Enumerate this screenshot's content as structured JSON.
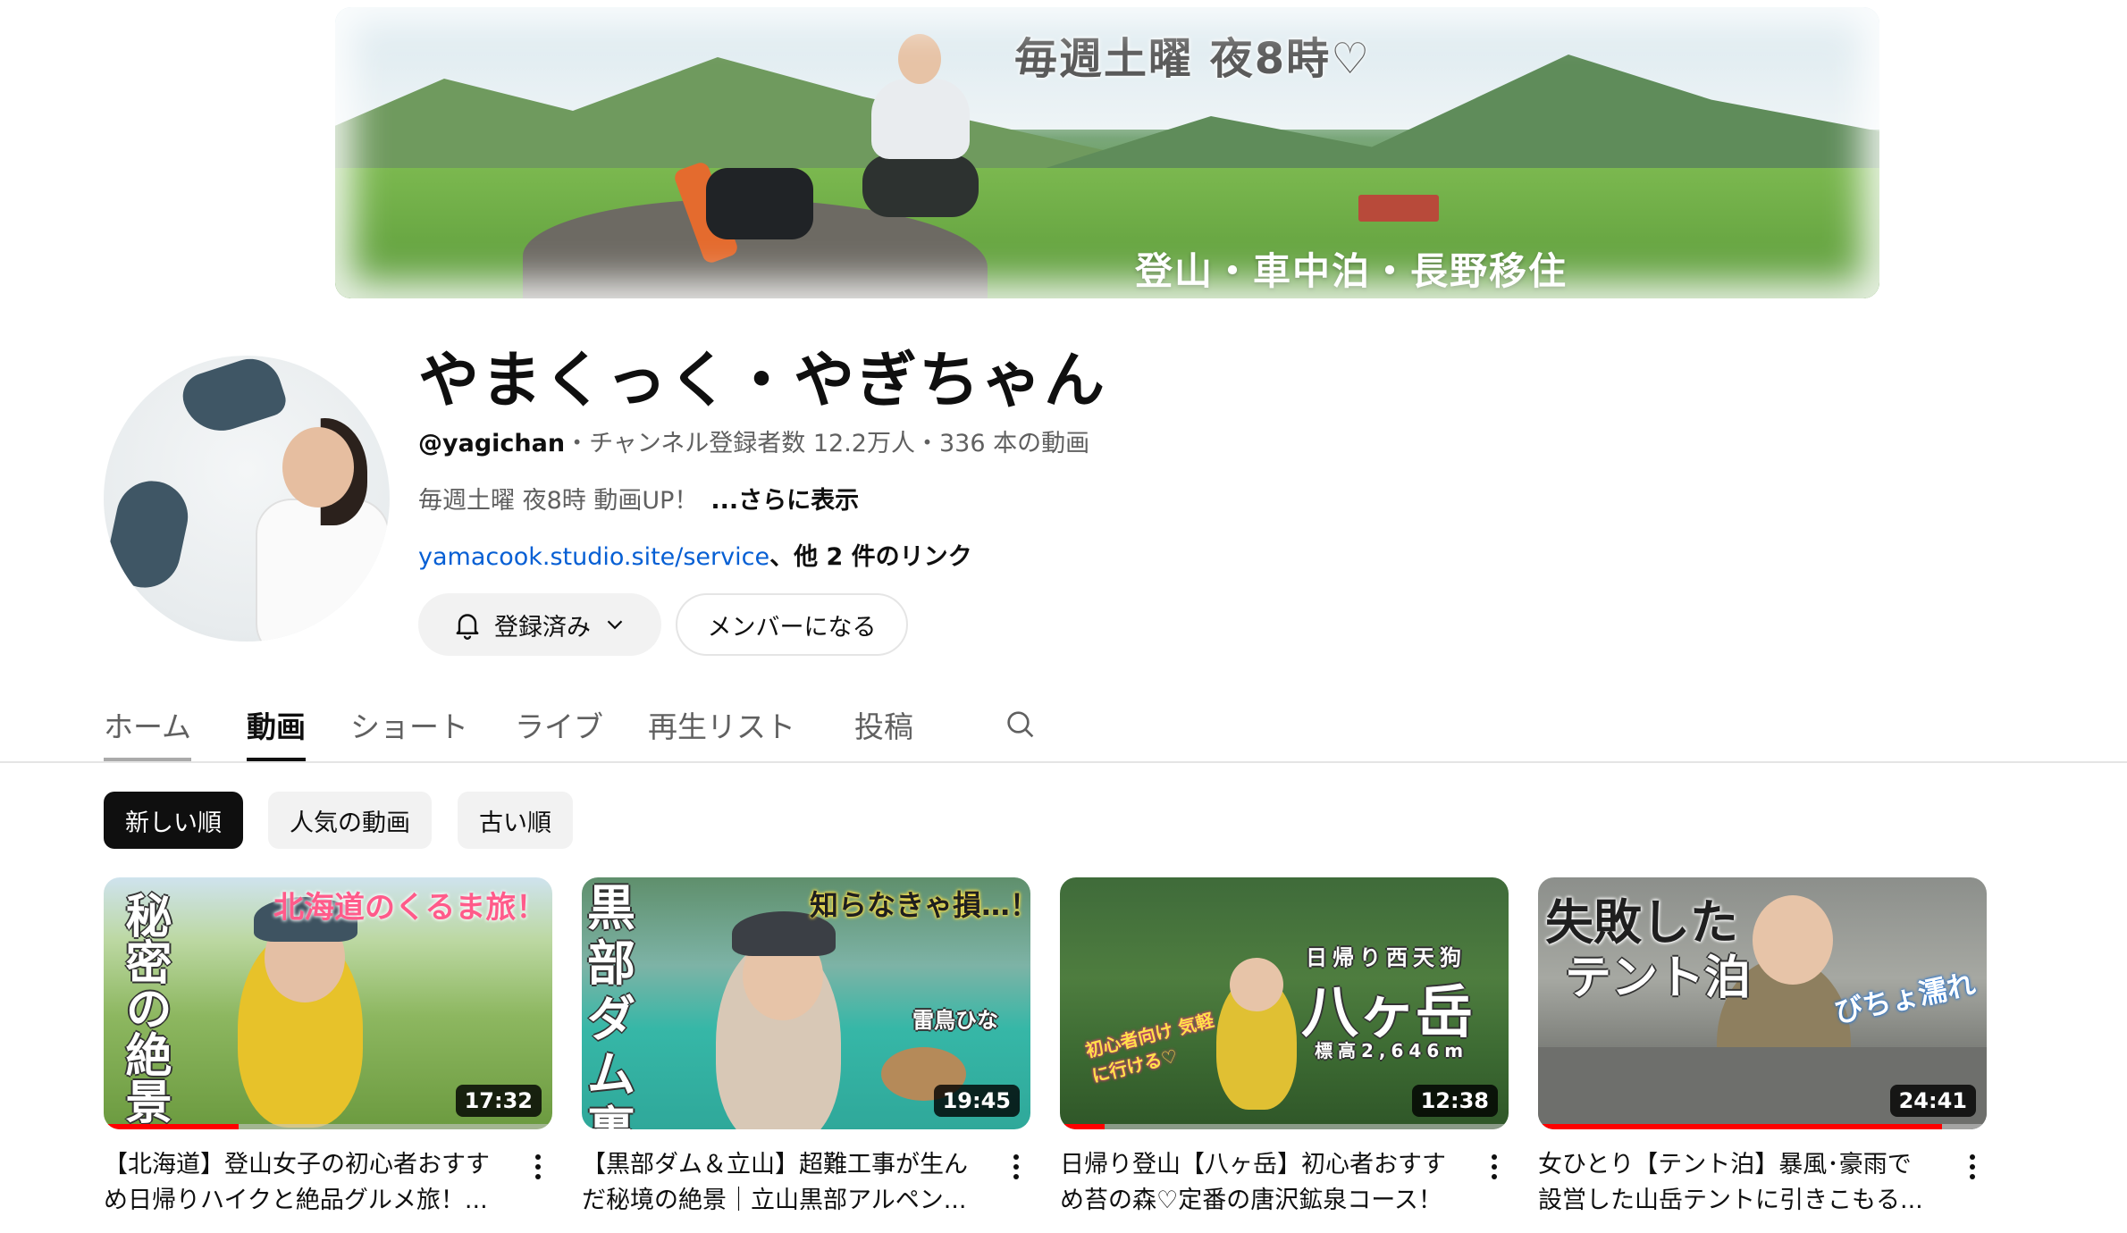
{
  "banner": {
    "tagline_top": "毎週土曜 夜8時♡",
    "tagline_bottom": "登山・車中泊・長野移住"
  },
  "channel": {
    "name": "やまくっく・やぎちゃん",
    "handle": "@yagichan",
    "stats": "・チャンネル登録者数 12.2万人・336 本の動画",
    "description": "毎週土曜 夜8時 動画UP！",
    "more_label": "...さらに表示",
    "link": "yamacook.studio.site/service",
    "other_links": "、他 2 件のリンク",
    "subscribe_label": "登録済み",
    "member_label": "メンバーになる"
  },
  "tabs": [
    {
      "label": "ホーム"
    },
    {
      "label": "動画"
    },
    {
      "label": "ショート"
    },
    {
      "label": "ライブ"
    },
    {
      "label": "再生リスト"
    },
    {
      "label": "投稿"
    }
  ],
  "chips": [
    {
      "label": "新しい順"
    },
    {
      "label": "人気の動画"
    },
    {
      "label": "古い順"
    }
  ],
  "videos": [
    {
      "title_line1": "【北海道】登山女子の初心者おすす",
      "title_line2": "め日帰りハイクと絶品グルメ旅！...",
      "duration": "17:32",
      "thumb_text_1": "北海道のくるま旅！",
      "thumb_text_2": "秘密の絶景",
      "watched": 0.3
    },
    {
      "title_line1": "【黒部ダム＆立山】超難工事が生ん",
      "title_line2": "だ秘境の絶景｜立山黒部アルペン...",
      "duration": "19:45",
      "thumb_text_1": "知らなきゃ損…！",
      "thumb_text_2": "黒部ダム裏側",
      "thumb_text_3": "雷鳥ひな",
      "watched": 0
    },
    {
      "title_line1": "日帰り登山【八ヶ岳】初心者おすす",
      "title_line2": "め苔の森♡定番の唐沢鉱泉コース！",
      "duration": "12:38",
      "thumb_text_1": "日帰り西天狗",
      "thumb_text_2": "八ヶ岳",
      "thumb_text_3": "標高2,646m",
      "thumb_text_4": "初心者向け 気軽に行ける♡",
      "watched": 0.1
    },
    {
      "title_line1": "女ひとり【テント泊】暴風･豪雨で",
      "title_line2": "設営した山岳テントに引きこもる...",
      "duration": "24:41",
      "thumb_text_1": "失敗した",
      "thumb_text_2": "テント泊",
      "thumb_text_3": "びちょ濡れ",
      "watched": 0.9
    }
  ],
  "colors": {
    "link": "#065fd4",
    "progress": "#ff0000",
    "chip_selected": "#0f0f0f",
    "chip": "#f2f2f2"
  },
  "icons": {
    "bell": "bell-icon",
    "chevron": "chevron-down-icon",
    "search": "search-icon",
    "kebab": "more-vert-icon"
  }
}
